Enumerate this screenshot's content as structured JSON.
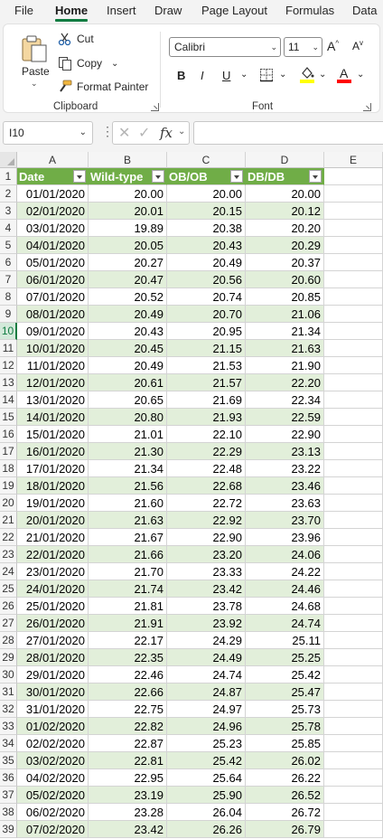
{
  "menu": {
    "tabs": [
      {
        "label": "File",
        "active": false
      },
      {
        "label": "Home",
        "active": true
      },
      {
        "label": "Insert",
        "active": false
      },
      {
        "label": "Draw",
        "active": false
      },
      {
        "label": "Page Layout",
        "active": false
      },
      {
        "label": "Formulas",
        "active": false
      },
      {
        "label": "Data",
        "active": false
      }
    ]
  },
  "ribbon": {
    "clipboard": {
      "paste_label": "Paste",
      "cut_label": "Cut",
      "copy_label": "Copy",
      "format_painter_label": "Format Painter",
      "group_label": "Clipboard"
    },
    "font": {
      "font_name": "Calibri",
      "font_size": "11",
      "group_label": "Font",
      "underline_color": "#ffff00",
      "font_color": "#ff0000"
    }
  },
  "formula_bar": {
    "name_box": "I10",
    "fx_label": "fx",
    "formula": ""
  },
  "sheet": {
    "columns": [
      "A",
      "B",
      "C",
      "D",
      "E"
    ],
    "headers": [
      "Date",
      "Wild-type",
      "OB/OB",
      "DB/DB"
    ],
    "header_color": "#70ad47",
    "band_color": "#e2efda",
    "active_row": 10,
    "rows": [
      {
        "num": "1"
      },
      {
        "num": "2",
        "cells": [
          "01/01/2020",
          "20.00",
          "20.00",
          "20.00"
        ]
      },
      {
        "num": "3",
        "cells": [
          "02/01/2020",
          "20.01",
          "20.15",
          "20.12"
        ]
      },
      {
        "num": "4",
        "cells": [
          "03/01/2020",
          "19.89",
          "20.38",
          "20.20"
        ]
      },
      {
        "num": "5",
        "cells": [
          "04/01/2020",
          "20.05",
          "20.43",
          "20.29"
        ]
      },
      {
        "num": "6",
        "cells": [
          "05/01/2020",
          "20.27",
          "20.49",
          "20.37"
        ]
      },
      {
        "num": "7",
        "cells": [
          "06/01/2020",
          "20.47",
          "20.56",
          "20.60"
        ]
      },
      {
        "num": "8",
        "cells": [
          "07/01/2020",
          "20.52",
          "20.74",
          "20.85"
        ]
      },
      {
        "num": "9",
        "cells": [
          "08/01/2020",
          "20.49",
          "20.70",
          "21.06"
        ]
      },
      {
        "num": "10",
        "cells": [
          "09/01/2020",
          "20.43",
          "20.95",
          "21.34"
        ]
      },
      {
        "num": "11",
        "cells": [
          "10/01/2020",
          "20.45",
          "21.15",
          "21.63"
        ]
      },
      {
        "num": "12",
        "cells": [
          "11/01/2020",
          "20.49",
          "21.53",
          "21.90"
        ]
      },
      {
        "num": "13",
        "cells": [
          "12/01/2020",
          "20.61",
          "21.57",
          "22.20"
        ]
      },
      {
        "num": "14",
        "cells": [
          "13/01/2020",
          "20.65",
          "21.69",
          "22.34"
        ]
      },
      {
        "num": "15",
        "cells": [
          "14/01/2020",
          "20.80",
          "21.93",
          "22.59"
        ]
      },
      {
        "num": "16",
        "cells": [
          "15/01/2020",
          "21.01",
          "22.10",
          "22.90"
        ]
      },
      {
        "num": "17",
        "cells": [
          "16/01/2020",
          "21.30",
          "22.29",
          "23.13"
        ]
      },
      {
        "num": "18",
        "cells": [
          "17/01/2020",
          "21.34",
          "22.48",
          "23.22"
        ]
      },
      {
        "num": "19",
        "cells": [
          "18/01/2020",
          "21.56",
          "22.68",
          "23.46"
        ]
      },
      {
        "num": "20",
        "cells": [
          "19/01/2020",
          "21.60",
          "22.72",
          "23.63"
        ]
      },
      {
        "num": "21",
        "cells": [
          "20/01/2020",
          "21.63",
          "22.92",
          "23.70"
        ]
      },
      {
        "num": "22",
        "cells": [
          "21/01/2020",
          "21.67",
          "22.90",
          "23.96"
        ]
      },
      {
        "num": "23",
        "cells": [
          "22/01/2020",
          "21.66",
          "23.20",
          "24.06"
        ]
      },
      {
        "num": "24",
        "cells": [
          "23/01/2020",
          "21.70",
          "23.33",
          "24.22"
        ]
      },
      {
        "num": "25",
        "cells": [
          "24/01/2020",
          "21.74",
          "23.42",
          "24.46"
        ]
      },
      {
        "num": "26",
        "cells": [
          "25/01/2020",
          "21.81",
          "23.78",
          "24.68"
        ]
      },
      {
        "num": "27",
        "cells": [
          "26/01/2020",
          "21.91",
          "23.92",
          "24.74"
        ]
      },
      {
        "num": "28",
        "cells": [
          "27/01/2020",
          "22.17",
          "24.29",
          "25.11"
        ]
      },
      {
        "num": "29",
        "cells": [
          "28/01/2020",
          "22.35",
          "24.49",
          "25.25"
        ]
      },
      {
        "num": "30",
        "cells": [
          "29/01/2020",
          "22.46",
          "24.74",
          "25.42"
        ]
      },
      {
        "num": "31",
        "cells": [
          "30/01/2020",
          "22.66",
          "24.87",
          "25.47"
        ]
      },
      {
        "num": "32",
        "cells": [
          "31/01/2020",
          "22.75",
          "24.97",
          "25.73"
        ]
      },
      {
        "num": "33",
        "cells": [
          "01/02/2020",
          "22.82",
          "24.96",
          "25.78"
        ]
      },
      {
        "num": "34",
        "cells": [
          "02/02/2020",
          "22.87",
          "25.23",
          "25.85"
        ]
      },
      {
        "num": "35",
        "cells": [
          "03/02/2020",
          "22.81",
          "25.42",
          "26.02"
        ]
      },
      {
        "num": "36",
        "cells": [
          "04/02/2020",
          "22.95",
          "25.64",
          "26.22"
        ]
      },
      {
        "num": "37",
        "cells": [
          "05/02/2020",
          "23.19",
          "25.90",
          "26.52"
        ]
      },
      {
        "num": "38",
        "cells": [
          "06/02/2020",
          "23.28",
          "26.04",
          "26.72"
        ]
      },
      {
        "num": "39",
        "cells": [
          "07/02/2020",
          "23.42",
          "26.26",
          "26.79"
        ]
      }
    ]
  }
}
